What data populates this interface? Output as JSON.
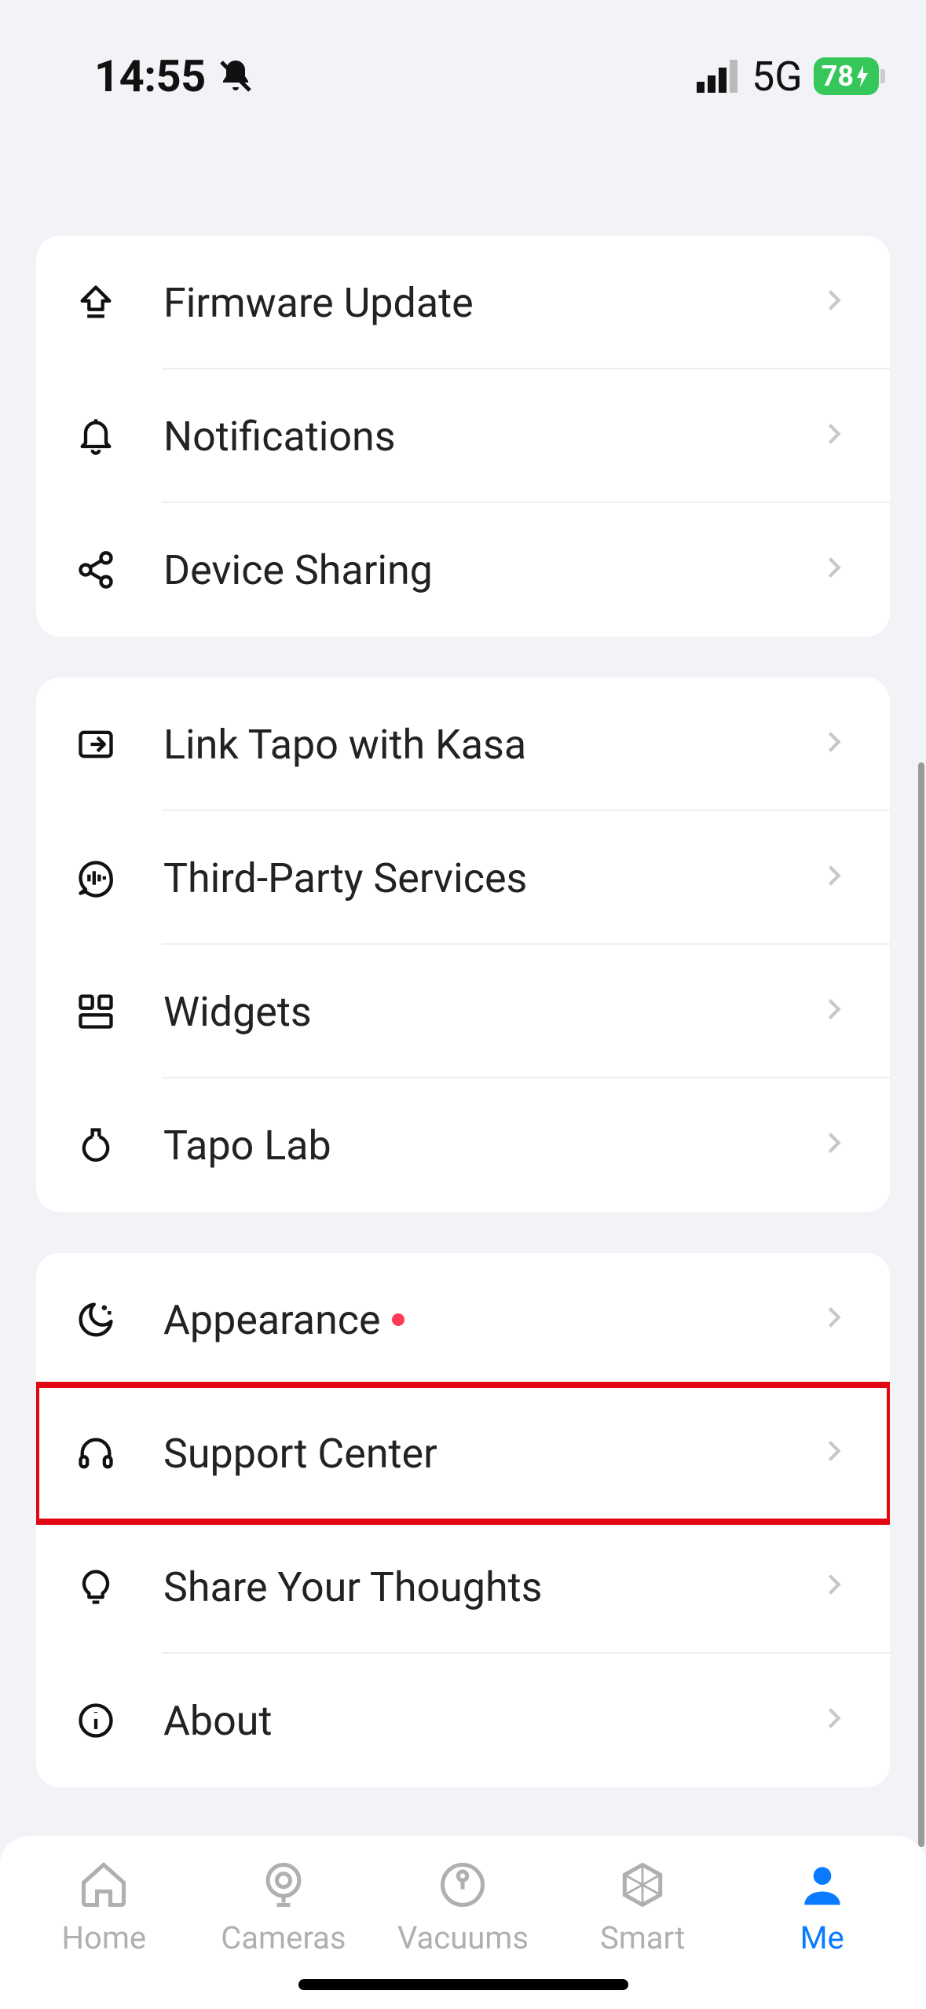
{
  "status": {
    "time": "14:55",
    "network": "5G",
    "battery": "78"
  },
  "groups": [
    {
      "items": [
        {
          "icon": "upload-icon",
          "label": "Firmware Update"
        },
        {
          "icon": "bell-icon",
          "label": "Notifications"
        },
        {
          "icon": "share-icon",
          "label": "Device Sharing"
        }
      ]
    },
    {
      "items": [
        {
          "icon": "link-box-icon",
          "label": "Link Tapo with Kasa"
        },
        {
          "icon": "voice-bubble-icon",
          "label": "Third-Party Services"
        },
        {
          "icon": "widgets-icon",
          "label": "Widgets"
        },
        {
          "icon": "flask-icon",
          "label": "Tapo Lab"
        }
      ]
    },
    {
      "items": [
        {
          "icon": "moon-icon",
          "label": "Appearance",
          "dot": true
        },
        {
          "icon": "headset-icon",
          "label": "Support Center",
          "highlighted": true
        },
        {
          "icon": "bulb-icon",
          "label": "Share Your Thoughts"
        },
        {
          "icon": "info-icon",
          "label": "About"
        }
      ]
    }
  ],
  "tabs": [
    {
      "icon": "home-tab-icon",
      "label": "Home"
    },
    {
      "icon": "camera-tab-icon",
      "label": "Cameras"
    },
    {
      "icon": "vacuum-tab-icon",
      "label": "Vacuums"
    },
    {
      "icon": "smart-tab-icon",
      "label": "Smart"
    },
    {
      "icon": "me-tab-icon",
      "label": "Me",
      "active": true
    }
  ]
}
